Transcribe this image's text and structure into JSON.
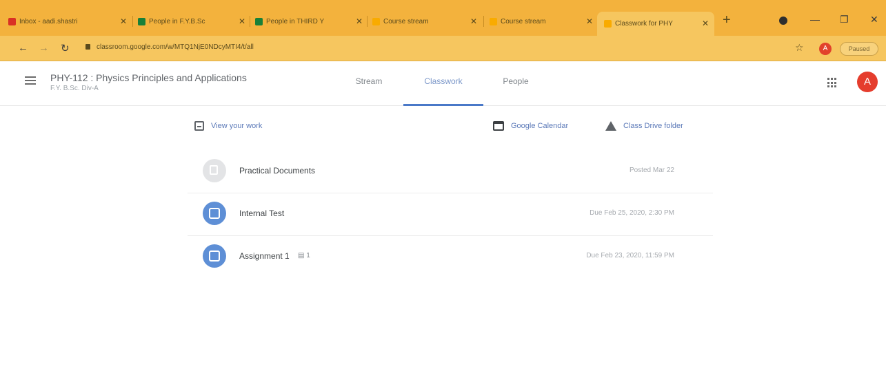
{
  "browser": {
    "tabs": [
      {
        "label": "Inbox - aadi.shastri",
        "favicon_color": "#d93025"
      },
      {
        "label": "People in F.Y.B.Sc",
        "favicon_color": "#188038"
      },
      {
        "label": "People in THIRD Y",
        "favicon_color": "#188038"
      },
      {
        "label": "Course stream",
        "favicon_color": "#f9ab00"
      },
      {
        "label": "Course stream",
        "favicon_color": "#f9ab00"
      },
      {
        "label": "Classwork for PHY",
        "favicon_color": "#f9ab00"
      }
    ],
    "url": "classroom.google.com/w/MTQ1NjE0NDcyMTI4/t/all",
    "profile_initial": "A",
    "paused_label": "Paused"
  },
  "header": {
    "course_title": "PHY-112 : Physics Principles and Applications",
    "course_subtitle": "F.Y. B.Sc. Div-A",
    "tabs": [
      {
        "label": "Stream"
      },
      {
        "label": "Classwork"
      },
      {
        "label": "People"
      }
    ],
    "avatar_initial": "A"
  },
  "toolbar": {
    "view_work": "View your work",
    "calendar": "Google Calendar",
    "drive": "Class Drive folder"
  },
  "items": [
    {
      "title": "Practical Documents",
      "comments": "",
      "date": "Posted Mar 22"
    },
    {
      "title": "Internal Test",
      "comments": "",
      "date": "Due Feb 25, 2020, 2:30 PM"
    },
    {
      "title": "Assignment 1",
      "comments": "1",
      "date": "Due Feb 23, 2020, 11:59 PM"
    }
  ],
  "colors": {
    "browser_frame": "#f3b23d",
    "accent": "#4a79c8",
    "material_icon": "#5e8fd6",
    "avatar": "#e53d2d"
  }
}
